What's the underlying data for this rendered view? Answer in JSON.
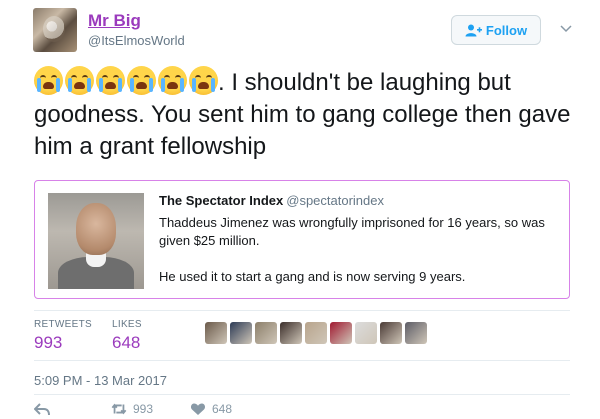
{
  "author": {
    "name": "Mr Big",
    "handle": "@ItsElmosWorld",
    "avatar_icon": "avatar-image"
  },
  "follow_button": {
    "label": "Follow",
    "icon": "follow-person-icon"
  },
  "menu_icon": "chevron-down-icon",
  "tweet": {
    "emoji_count": 6,
    "emoji_name": "loudly-crying-face-emoji",
    "text": ". I shouldn't be laughing but goodness. You sent him to gang college then gave him a grant fellowship"
  },
  "quoted_tweet": {
    "author_name": "The Spectator Index",
    "author_handle": "@spectatorindex",
    "paragraphs": [
      "Thaddeus Jimenez was wrongfully imprisoned for 16 years, so was given $25 million.",
      "He used it to start a gang and is now serving 9 years."
    ],
    "photo_icon": "mugshot-photo"
  },
  "stats": {
    "retweets_label": "RETWEETS",
    "retweets_value": "993",
    "likes_label": "LIKES",
    "likes_value": "648"
  },
  "liker_avatars": [
    "#6b5a4a",
    "#2c3a55",
    "#8c7f6a",
    "#3b2e2a",
    "#b8a48c",
    "#a01830",
    "#dcdcdc",
    "#4a3a35",
    "#5c5c66"
  ],
  "timestamp": "5:09 PM - 13 Mar 2017",
  "actions": {
    "reply_icon": "reply-icon",
    "retweet_icon": "retweet-icon",
    "retweet_count": "993",
    "like_icon": "heart-icon",
    "like_count": "648"
  },
  "colors": {
    "accent": "#9b3bbd",
    "link_blue": "#1da1f2",
    "quote_border": "#d782e8",
    "muted": "#657786"
  }
}
